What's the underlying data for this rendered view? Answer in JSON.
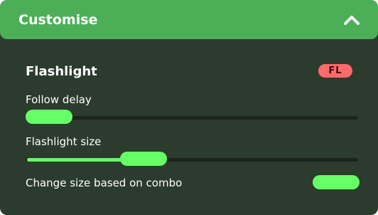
{
  "header": {
    "title": "Customise",
    "collapse_icon": "chevron-up-icon"
  },
  "mod": {
    "title": "Flashlight",
    "badge": "FL",
    "badge_color": "#ff6b6b"
  },
  "settings": {
    "follow_delay": {
      "label": "Follow delay",
      "value_fraction": 0.0
    },
    "flashlight_size": {
      "label": "Flashlight size",
      "value_fraction": 0.33
    },
    "change_size_based_on_combo": {
      "label": "Change size based on combo",
      "enabled": true
    }
  },
  "colors": {
    "panel_background": "#2b3b2d",
    "header_background": "#4caf58",
    "accent": "#66ff66",
    "track": "#1b241c"
  }
}
